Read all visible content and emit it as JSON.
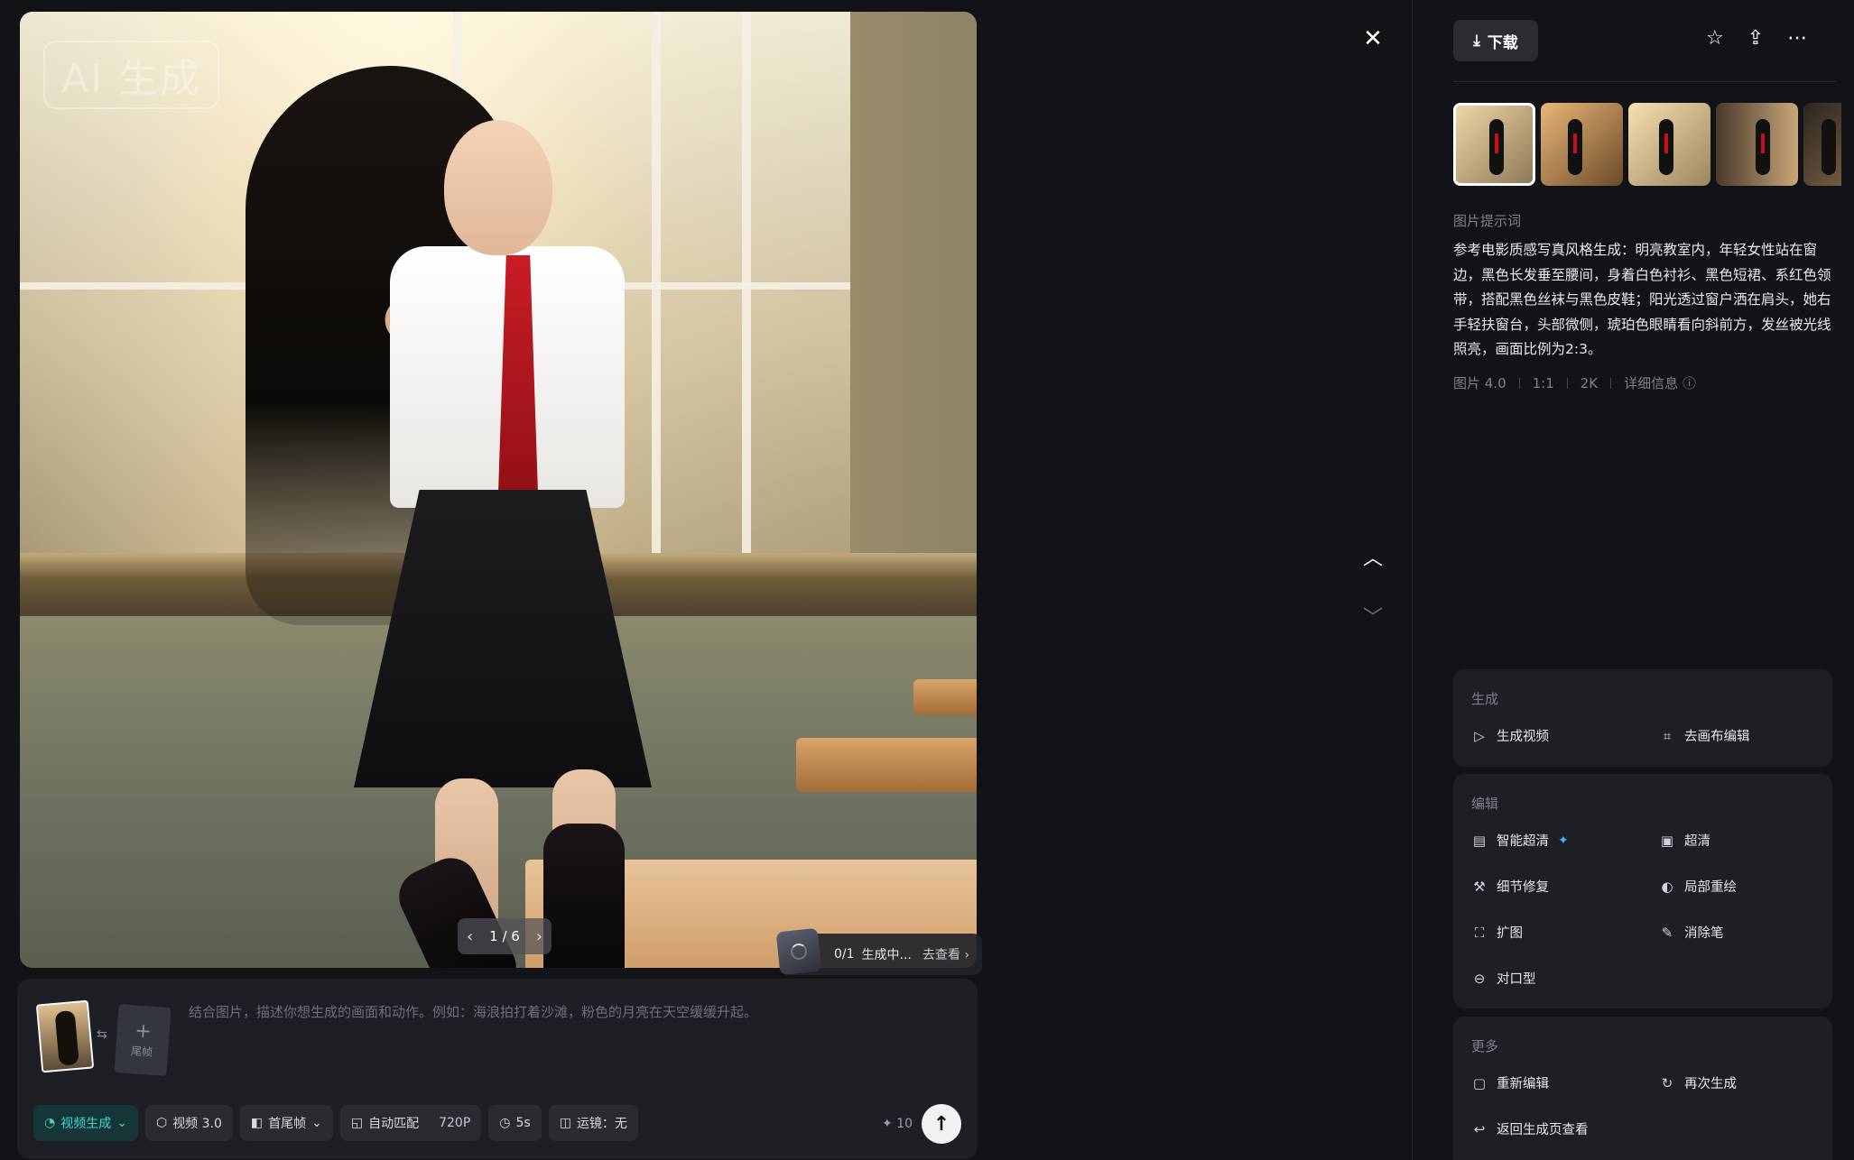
{
  "viewer": {
    "watermark": "AI 生成",
    "pager": {
      "current": "1 / 6",
      "prev_icon": "chevron-left-icon",
      "next_icon": "chevron-right-icon"
    },
    "generation_status": {
      "count": "0/1",
      "text": "生成中...",
      "action": "去查看"
    }
  },
  "composer": {
    "tail_frame_label": "尾帧",
    "prompt_placeholder": "结合图片，描述你想生成的画面和动作。例如：海浪拍打着沙滩，粉色的月亮在天空缓缓升起。",
    "toolbar": {
      "mode": "视频生成",
      "model": "视频 3.0",
      "frames": "首尾帧",
      "ratio": "自动匹配",
      "resolution": "720P",
      "duration": "5s",
      "camera": "运镜：无"
    },
    "credits": "10"
  },
  "panel": {
    "download_label": "下载",
    "prompt_section_label": "图片提示词",
    "prompt_text": "参考电影质感写真风格生成：明亮教室内，年轻女性站在窗边，黑色长发垂至腰间，身着白色衬衫、黑色短裙、系红色领带，搭配黑色丝袜与黑色皮鞋；阳光透过窗户洒在肩头，她右手轻扶窗台，头部微侧，琥珀色眼睛看向斜前方，发丝被光线照亮，画面比例为2:3。",
    "meta": {
      "model": "图片 4.0",
      "ratio": "1:1",
      "quality": "2K",
      "details": "详细信息"
    },
    "sections": {
      "generate": {
        "title": "生成",
        "items": [
          "生成视频",
          "去画布编辑"
        ]
      },
      "edit": {
        "title": "编辑",
        "items": [
          "智能超清",
          "超清",
          "细节修复",
          "局部重绘",
          "扩图",
          "消除笔",
          "对口型"
        ]
      },
      "more": {
        "title": "更多",
        "items": [
          "重新编辑",
          "再次生成",
          "返回生成页查看"
        ]
      }
    }
  },
  "colors": {
    "accent": "#3ed6cf",
    "tie_red": "#c81d25",
    "panel_bg": "#1e1f24",
    "sparkle": "#39b6ff"
  }
}
